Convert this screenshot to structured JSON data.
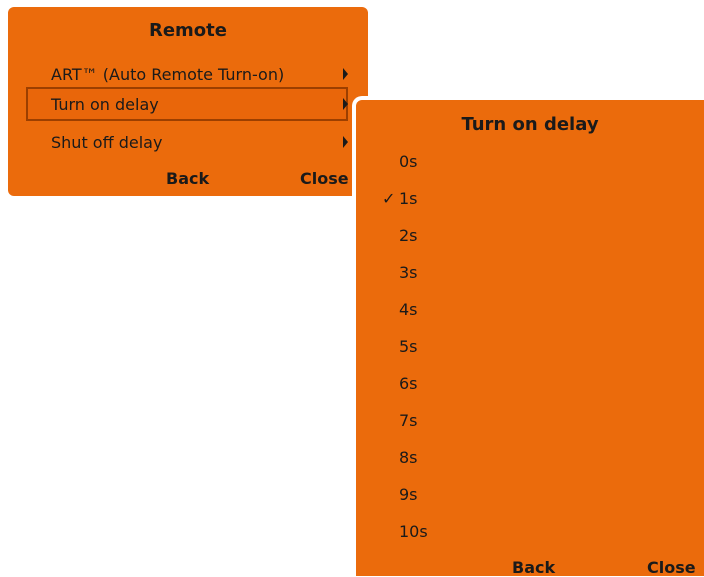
{
  "remote_menu": {
    "title": "Remote",
    "items": [
      {
        "label": "ART™ (Auto Remote Turn-on)",
        "selected": false
      },
      {
        "label": "Turn on delay",
        "selected": true
      },
      {
        "label": "Shut off delay",
        "selected": false
      }
    ],
    "back_label": "Back",
    "close_label": "Close"
  },
  "delay_menu": {
    "title": "Turn on delay",
    "checkmark": "✓",
    "options": [
      "0s",
      "1s",
      "2s",
      "3s",
      "4s",
      "5s",
      "6s",
      "7s",
      "8s",
      "9s",
      "10s"
    ],
    "selected_index": 1,
    "back_label": "Back",
    "close_label": "Close"
  },
  "colors": {
    "panel": "#EB6B0C",
    "selection_border": "#9C3F00",
    "text": "#1a1a1a"
  },
  "icons": {
    "submenu_arrow": "chevron-right-icon",
    "selected_mark": "checkmark-icon"
  }
}
